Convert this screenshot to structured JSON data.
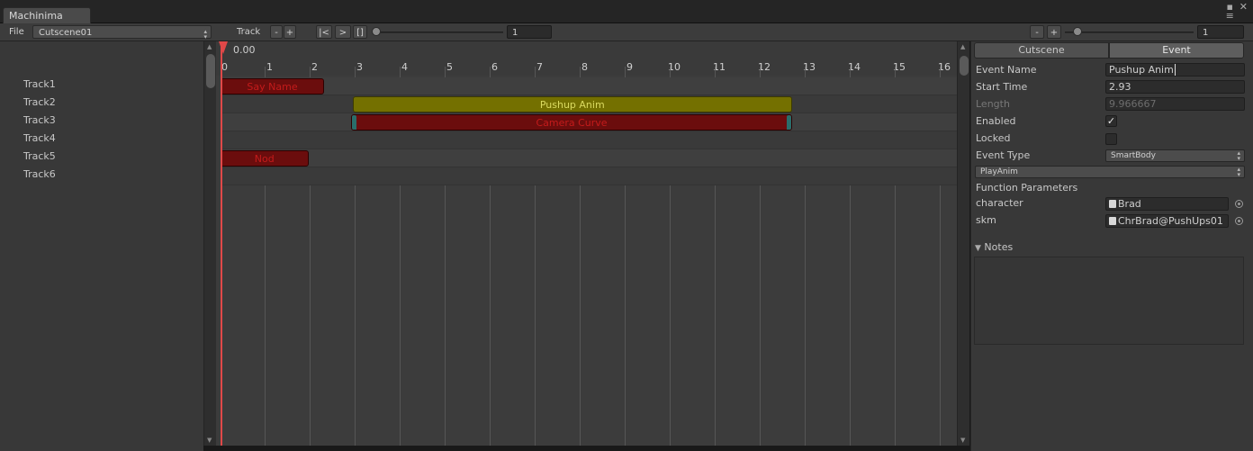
{
  "window": {
    "tab_title": "Machinima",
    "controls": [
      "▪",
      "✕",
      "≡"
    ]
  },
  "toolbar": {
    "file_menu": "File",
    "cutscene_select": "Cutscene01",
    "track_label": "Track",
    "track_minus": "-",
    "track_plus": "+",
    "go_start": "|<",
    "play": ">",
    "stop": "[]",
    "timeline_speed_value": "1",
    "zoom_minus": "-",
    "zoom_plus": "+",
    "zoom_value": "1"
  },
  "tracks": [
    "Track1",
    "Track2",
    "Track3",
    "Track4",
    "Track5",
    "Track6"
  ],
  "timeline": {
    "current_time": "0.00",
    "ticks": [
      "0",
      "1",
      "2",
      "3",
      "4",
      "5",
      "6",
      "7",
      "8",
      "9",
      "10",
      "11",
      "12",
      "13",
      "14",
      "15",
      "16"
    ],
    "clips": [
      {
        "label": "Say Name",
        "track": 1,
        "start": 0.0,
        "end": 2.3,
        "color": "#6b0d0d"
      },
      {
        "label": "Pushup Anim",
        "track": 2,
        "start": 2.93,
        "end": 12.7,
        "color": "#747000"
      },
      {
        "label": "Camera Curve",
        "track": 3,
        "start": 2.9,
        "end": 12.7,
        "color": "#6b0d0d"
      },
      {
        "label": "Nod",
        "track": 5,
        "start": 0.0,
        "end": 1.95,
        "color": "#6b0d0d"
      }
    ]
  },
  "inspector": {
    "tabs": [
      "Cutscene",
      "Event"
    ],
    "active_tab": "Event",
    "event_name_label": "Event Name",
    "event_name_value": "Pushup Anim",
    "start_time_label": "Start Time",
    "start_time_value": "2.93",
    "length_label": "Length",
    "length_value": "9.966667",
    "enabled_label": "Enabled",
    "enabled_checked": true,
    "locked_label": "Locked",
    "locked_checked": false,
    "event_type_label": "Event Type",
    "event_type_value": "SmartBody",
    "function_value": "PlayAnim",
    "function_params_label": "Function Parameters",
    "character_label": "character",
    "character_value": "Brad",
    "skm_label": "skm",
    "skm_value": "ChrBrad@PushUps01",
    "notes_label": "Notes"
  }
}
